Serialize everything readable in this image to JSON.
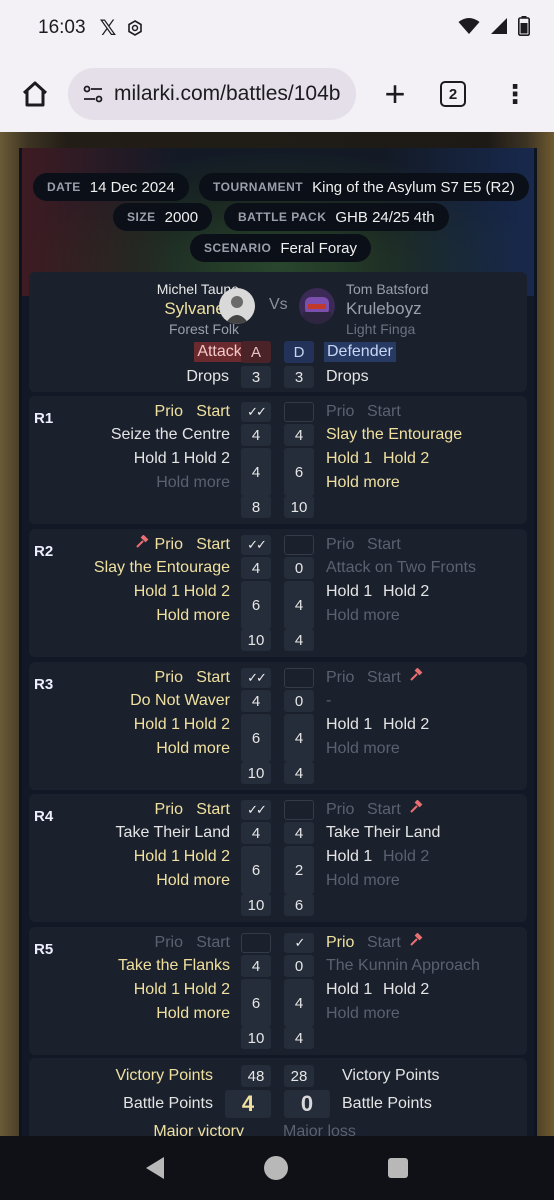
{
  "status": {
    "time": "16:03",
    "app_x": "𝕏"
  },
  "browser": {
    "url": "milarki.com/battles/104b",
    "tab_count": "2"
  },
  "meta": {
    "date_label": "DATE",
    "date": "14 Dec 2024",
    "tournament_label": "TOURNAMENT",
    "tournament": "King of the Asylum S7 E5 (R2)",
    "size_label": "SIZE",
    "size": "2000",
    "pack_label": "BATTLE PACK",
    "pack": "GHB 24/25 4th",
    "scenario_label": "SCENARIO",
    "scenario": "Feral Foray"
  },
  "players": {
    "left": {
      "name": "Michel Taune",
      "faction": "Sylvaneth",
      "subfaction": "Forest Folk"
    },
    "vs": "Vs",
    "right": {
      "name": "Tom Batsford",
      "faction": "Kruleboyz",
      "subfaction": "Light Finga"
    },
    "attacker_label": "Attacker",
    "attacker_letter": "A",
    "defender_letter": "D",
    "defender_label": "Defender",
    "drops_label": "Drops",
    "left_drops": "3",
    "right_drops": "3"
  },
  "labels": {
    "prio": "Prio",
    "start": "Start",
    "hold1": "Hold 1",
    "hold2": "Hold 2",
    "hold_more": "Hold more",
    "check": "✓✓",
    "single_check": "✓"
  },
  "rounds": [
    {
      "label": "R1",
      "left_obj": "Seize the Centre",
      "left_obj_score": "4",
      "right_obj_score": "4",
      "right_obj": "Slay the Entourage",
      "left_hold": "4",
      "right_hold": "6",
      "left_total": "8",
      "right_total": "10"
    },
    {
      "label": "R2",
      "left_obj": "Slay the Entourage",
      "left_obj_score": "4",
      "right_obj_score": "0",
      "right_obj": "Attack on Two Fronts",
      "left_hold": "6",
      "right_hold": "4",
      "left_total": "10",
      "right_total": "4"
    },
    {
      "label": "R3",
      "left_obj": "Do Not Waver",
      "left_obj_score": "4",
      "right_obj_score": "0",
      "right_obj": "-",
      "left_hold": "6",
      "right_hold": "4",
      "left_total": "10",
      "right_total": "4"
    },
    {
      "label": "R4",
      "left_obj": "Take Their Land",
      "left_obj_score": "4",
      "right_obj_score": "4",
      "right_obj": "Take Their Land",
      "left_hold": "6",
      "right_hold": "2",
      "left_total": "10",
      "right_total": "6"
    },
    {
      "label": "R5",
      "left_obj": "Take the Flanks",
      "left_obj_score": "4",
      "right_obj_score": "0",
      "right_obj": "The Kunnin Approach",
      "left_hold": "6",
      "right_hold": "4",
      "left_total": "10",
      "right_total": "4"
    }
  ],
  "totals": {
    "vp_label": "Victory Points",
    "left_vp": "48",
    "right_vp": "28",
    "bp_label": "Battle Points",
    "left_bp": "4",
    "right_bp": "0",
    "left_result": "Major victory",
    "right_result": "Major loss"
  },
  "colors": {
    "yellow": "#efe0a0",
    "panel": "#1a202c",
    "attacker": "#6b2a2e",
    "defender": "#263a63",
    "hammer": "#e87070"
  },
  "icons": [
    "home-icon",
    "site-settings-icon",
    "plus-icon",
    "tab-switcher-icon",
    "more-vert-icon",
    "hammer-icon",
    "check-icon",
    "wifi-icon",
    "signal-icon",
    "battery-icon"
  ]
}
